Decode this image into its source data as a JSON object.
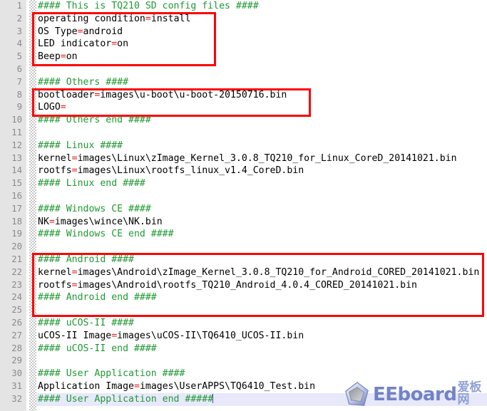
{
  "editor": {
    "title": "TQ210 SD config file",
    "font_size_px": 13,
    "colors": {
      "comment_green": "#1f9a32",
      "equals_red": "#e01b1b",
      "text_black": "#000000",
      "gutter_bg": "#e4e4e4",
      "lineno_gray": "#8a8a8a",
      "active_line_bg": "#e8e8fb",
      "annotation_red": "#fc0404",
      "caret": "#3b4cc0"
    },
    "active_line": 32,
    "total_lines": 32
  },
  "lines": [
    {
      "n": "1",
      "tokens": [
        {
          "t": "#### This is TQ210 SD config files ####",
          "k": "comment"
        }
      ]
    },
    {
      "n": "2",
      "tokens": [
        {
          "t": "operating condition",
          "k": "text"
        },
        {
          "t": "=",
          "k": "eq"
        },
        {
          "t": "install",
          "k": "text"
        }
      ]
    },
    {
      "n": "3",
      "tokens": [
        {
          "t": "OS Type",
          "k": "text"
        },
        {
          "t": "=",
          "k": "eq"
        },
        {
          "t": "android",
          "k": "text"
        }
      ]
    },
    {
      "n": "4",
      "tokens": [
        {
          "t": "LED indicator",
          "k": "text"
        },
        {
          "t": "=",
          "k": "eq"
        },
        {
          "t": "on",
          "k": "text"
        }
      ]
    },
    {
      "n": "5",
      "tokens": [
        {
          "t": "Beep",
          "k": "text"
        },
        {
          "t": "=",
          "k": "eq"
        },
        {
          "t": "on",
          "k": "text"
        }
      ]
    },
    {
      "n": "6",
      "tokens": []
    },
    {
      "n": "7",
      "tokens": [
        {
          "t": "#### Others ####",
          "k": "comment"
        }
      ]
    },
    {
      "n": "8",
      "tokens": [
        {
          "t": "bootloader",
          "k": "text"
        },
        {
          "t": "=",
          "k": "eq"
        },
        {
          "t": "images\\u-boot\\u-boot-20150716.bin",
          "k": "text"
        }
      ]
    },
    {
      "n": "9",
      "tokens": [
        {
          "t": "LOGO",
          "k": "text"
        },
        {
          "t": "=",
          "k": "eq"
        }
      ]
    },
    {
      "n": "10",
      "tokens": [
        {
          "t": "#### Others end ####",
          "k": "comment"
        }
      ]
    },
    {
      "n": "11",
      "tokens": []
    },
    {
      "n": "12",
      "tokens": [
        {
          "t": "#### Linux ####",
          "k": "comment"
        }
      ]
    },
    {
      "n": "13",
      "tokens": [
        {
          "t": "kernel",
          "k": "text"
        },
        {
          "t": "=",
          "k": "eq"
        },
        {
          "t": "images\\Linux\\zImage_Kernel_3.0.8_TQ210_for_Linux_CoreD_20141021.bin",
          "k": "text"
        }
      ]
    },
    {
      "n": "14",
      "tokens": [
        {
          "t": "rootfs",
          "k": "text"
        },
        {
          "t": "=",
          "k": "eq"
        },
        {
          "t": "images\\Linux\\rootfs_linux_v1.4_CoreD.bin",
          "k": "text"
        }
      ]
    },
    {
      "n": "15",
      "tokens": [
        {
          "t": "#### Linux end ####",
          "k": "comment"
        }
      ]
    },
    {
      "n": "16",
      "tokens": []
    },
    {
      "n": "17",
      "tokens": [
        {
          "t": "#### Windows CE ####",
          "k": "comment"
        }
      ]
    },
    {
      "n": "18",
      "tokens": [
        {
          "t": "NK",
          "k": "text"
        },
        {
          "t": "=",
          "k": "eq"
        },
        {
          "t": "images\\wince\\NK.bin",
          "k": "text"
        }
      ]
    },
    {
      "n": "19",
      "tokens": [
        {
          "t": "#### Windows CE end ####",
          "k": "comment"
        }
      ]
    },
    {
      "n": "20",
      "tokens": []
    },
    {
      "n": "21",
      "tokens": [
        {
          "t": "#### Android ####",
          "k": "comment"
        }
      ]
    },
    {
      "n": "22",
      "tokens": [
        {
          "t": "kernel",
          "k": "text"
        },
        {
          "t": "=",
          "k": "eq"
        },
        {
          "t": "images\\Android\\zImage_Kernel_3.0.8_TQ210_for_Android_CORED_20141021.bin",
          "k": "text"
        }
      ]
    },
    {
      "n": "23",
      "tokens": [
        {
          "t": "rootfs",
          "k": "text"
        },
        {
          "t": "=",
          "k": "eq"
        },
        {
          "t": "images\\Android\\rootfs_TQ210_Android_4.0.4_CORED_20141021.bin",
          "k": "text"
        }
      ]
    },
    {
      "n": "24",
      "tokens": [
        {
          "t": "#### Android end ####",
          "k": "comment"
        }
      ]
    },
    {
      "n": "25",
      "tokens": []
    },
    {
      "n": "26",
      "tokens": [
        {
          "t": "#### uCOS-II ####",
          "k": "comment"
        }
      ]
    },
    {
      "n": "27",
      "tokens": [
        {
          "t": "uCOS-II Image",
          "k": "text"
        },
        {
          "t": "=",
          "k": "eq"
        },
        {
          "t": "images\\uCOS-II\\TQ6410_UCOS-II.bin",
          "k": "text"
        }
      ]
    },
    {
      "n": "28",
      "tokens": [
        {
          "t": "#### uCOS-II end ####",
          "k": "comment"
        }
      ]
    },
    {
      "n": "29",
      "tokens": []
    },
    {
      "n": "30",
      "tokens": [
        {
          "t": "#### User Application ####",
          "k": "comment"
        }
      ]
    },
    {
      "n": "31",
      "tokens": [
        {
          "t": "Application Image",
          "k": "text"
        },
        {
          "t": "=",
          "k": "eq"
        },
        {
          "t": "images\\UserAPPS\\TQ6410_Test.bin",
          "k": "text"
        }
      ]
    },
    {
      "n": "32",
      "tokens": [
        {
          "t": "#### User Application end #####",
          "k": "comment"
        }
      ],
      "caret": true,
      "active": true
    }
  ],
  "annotations": [
    {
      "id": "redbox-1",
      "label": "install-settings-highlight",
      "covers_lines": "2-5"
    },
    {
      "id": "redbox-2",
      "label": "bootloader-logo-highlight",
      "covers_lines": "8-9"
    },
    {
      "id": "redbox-3",
      "label": "android-section-highlight",
      "covers_lines": "21-24"
    }
  ],
  "watermark": {
    "brand": "EEboard",
    "brand_cn": "爱板网",
    "logo_icon": "diamond-logo-icon"
  }
}
